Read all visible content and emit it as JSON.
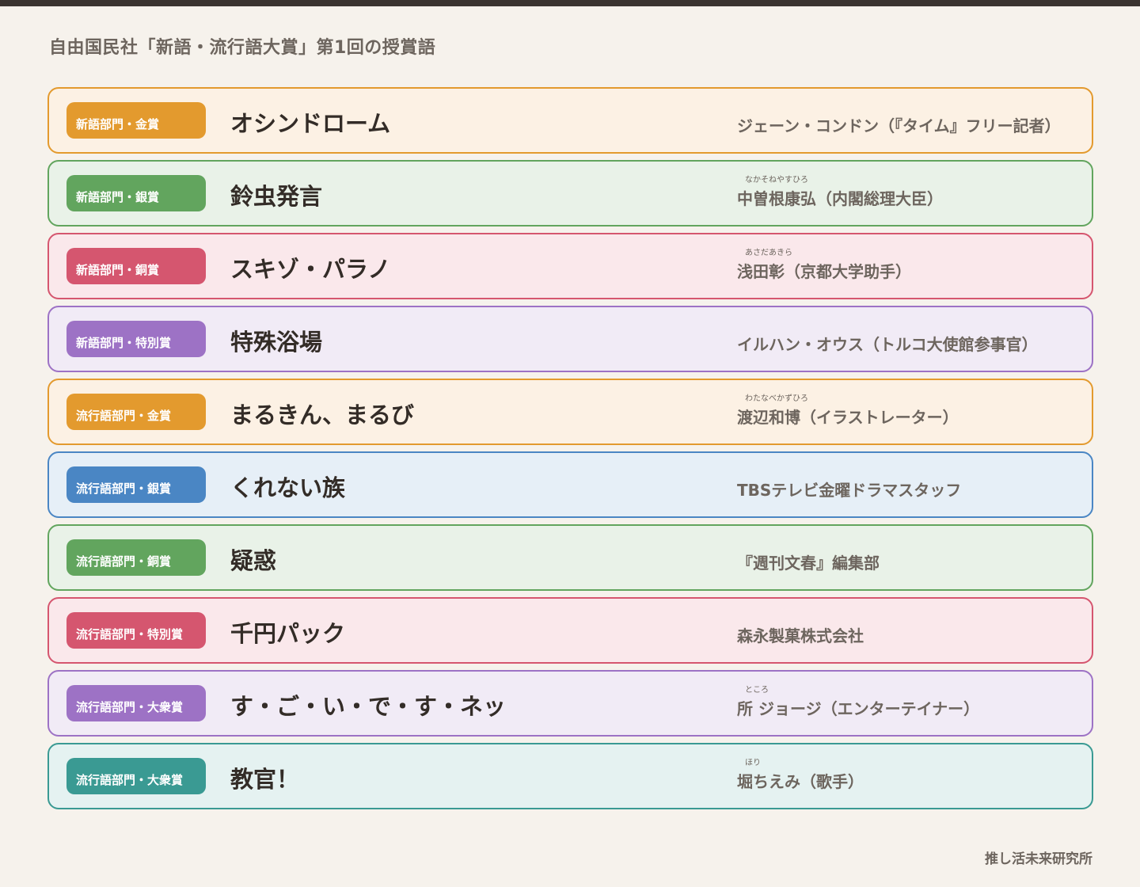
{
  "title": "自由国民社「新語・流行語大賞」第1回の授賞語",
  "credit": "推し活未来研究所",
  "awards": [
    {
      "category": "新語部門・金賞",
      "word": "オシンドローム",
      "recipient": "ジェーン・コンドン（『タイム』フリー記者）",
      "ruby": "",
      "color": "#e39a2e",
      "bg": "#fcf1e4"
    },
    {
      "category": "新語部門・銀賞",
      "word": "鈴虫発言",
      "recipient": "中曽根康弘（内閣総理大臣）",
      "ruby": "なかそねやすひろ",
      "color": "#62a55e",
      "bg": "#e9f2e8"
    },
    {
      "category": "新語部門・銅賞",
      "word": "スキゾ・パラノ",
      "recipient": "浅田彰（京都大学助手）",
      "ruby": "あさだあきら",
      "color": "#d5566f",
      "bg": "#fae8eb"
    },
    {
      "category": "新語部門・特別賞",
      "word": "特殊浴場",
      "recipient": "イルハン・オウス（トルコ大使館参事官）",
      "ruby": "",
      "color": "#9d72c5",
      "bg": "#f1ebf6"
    },
    {
      "category": "流行語部門・金賞",
      "word": "まるきん、まるび",
      "recipient": "渡辺和博（イラストレーター）",
      "ruby": "わたなべかずひろ",
      "color": "#e39a2e",
      "bg": "#fcf1e4"
    },
    {
      "category": "流行語部門・銀賞",
      "word": "くれない族",
      "recipient": "TBSテレビ金曜ドラマスタッフ",
      "ruby": "",
      "color": "#4a86c4",
      "bg": "#e6eff7"
    },
    {
      "category": "流行語部門・銅賞",
      "word": "疑惑",
      "recipient": "『週刊文春』編集部",
      "ruby": "",
      "color": "#62a55e",
      "bg": "#e9f2e8"
    },
    {
      "category": "流行語部門・特別賞",
      "word": "千円パック",
      "recipient": "森永製菓株式会社",
      "ruby": "",
      "color": "#d5566f",
      "bg": "#fae8eb"
    },
    {
      "category": "流行語部門・大衆賞",
      "word": "す・ご・い・で・す・ネッ",
      "recipient": " 所 ジョージ（エンターテイナー）",
      "ruby": "ところ",
      "color": "#9d72c5",
      "bg": "#f1ebf6"
    },
    {
      "category": "流行語部門・大衆賞",
      "word": "教官！",
      "recipient": "堀ちえみ（歌手）",
      "ruby": "ほり",
      "color": "#3a9a93",
      "bg": "#e5f2f1"
    }
  ]
}
